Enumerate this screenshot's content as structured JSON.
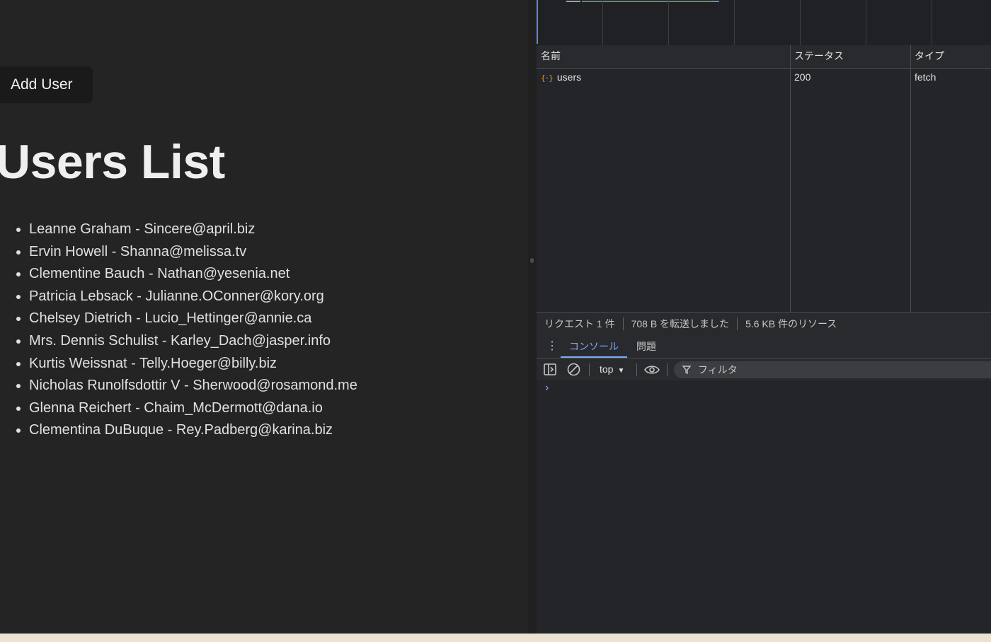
{
  "app": {
    "add_user_label": "Add User",
    "title": "Users List",
    "users": [
      "Leanne Graham - Sincere@april.biz",
      "Ervin Howell - Shanna@melissa.tv",
      "Clementine Bauch - Nathan@yesenia.net",
      "Patricia Lebsack - Julianne.OConner@kory.org",
      "Chelsey Dietrich - Lucio_Hettinger@annie.ca",
      "Mrs. Dennis Schulist - Karley_Dach@jasper.info",
      "Kurtis Weissnat - Telly.Hoeger@billy.biz",
      "Nicholas Runolfsdottir V - Sherwood@rosamond.me",
      "Glenna Reichert - Chaim_McDermott@dana.io",
      "Clementina DuBuque - Rey.Padberg@karina.biz"
    ]
  },
  "network": {
    "columns": {
      "name": "名前",
      "status": "ステータス",
      "type": "タイプ"
    },
    "rows": [
      {
        "icon": "json-icon",
        "name": "users",
        "status": "200",
        "type": "fetch"
      }
    ],
    "summary": {
      "requests": "リクエスト 1 件",
      "transferred": "708 B を転送しました",
      "resources": "5.6 KB 件のリソース"
    }
  },
  "drawer": {
    "tabs": {
      "console": "コンソール",
      "issues": "問題"
    },
    "context": "top",
    "filter_placeholder": "フィルタ",
    "prompt": "›"
  },
  "colors": {
    "page_bg": "#242424",
    "devtools_bg": "#292a2d",
    "accent_blue": "#7cacf8",
    "json_icon": "#f29900"
  }
}
